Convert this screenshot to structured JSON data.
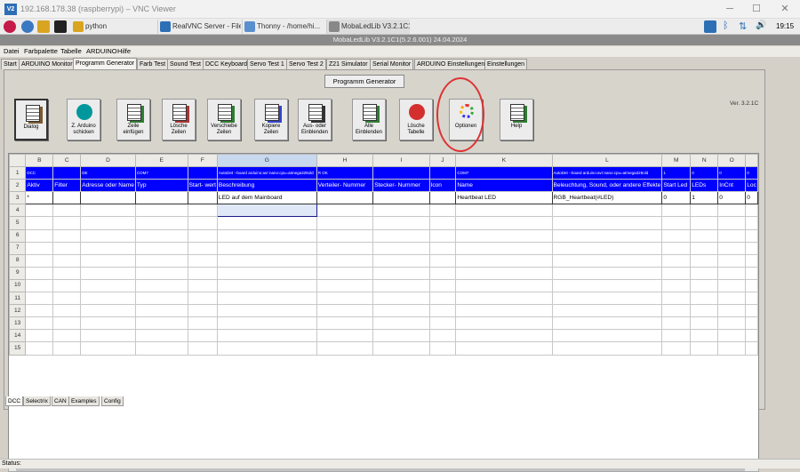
{
  "vnc": {
    "title": "192.168.178.38 (raspberrypi) – VNC Viewer",
    "logo_text": "V2",
    "minimize": "─",
    "maximize": "☐",
    "close": "✕"
  },
  "taskbar": {
    "python_label": "python",
    "tasks": [
      "RealVNC Server - File...",
      "Thonny - /home/hi...",
      "MobaLedLib V3.2.1C1(..."
    ],
    "tray_icons": [
      "vnc-icon",
      "bluetooth-icon",
      "network-icon",
      "volume-icon"
    ],
    "time": "19:15"
  },
  "app_title": "MobaLedLib V3.2.1C1(5.2.6.001) 24.04.2024",
  "menu": [
    "Datei",
    "Farbpalette",
    "Tabelle",
    "ARDUINO",
    "Hilfe"
  ],
  "tabs": [
    "Start",
    "ARDUINO Monitor",
    "Programm Generator",
    "Farb Test",
    "Sound Test",
    "DCC Keyboard",
    "Servo Test 1",
    "Servo Test 2",
    "Z21 Simulator",
    "Serial Monitor",
    "ARDUINO Einstellungen",
    "Einstellungen"
  ],
  "active_tab": "Programm Generator",
  "panel_title": "Programm Generator",
  "version": "Ver. 3.2.1C",
  "toolbar": [
    {
      "name": "dialog",
      "label": "Dialog",
      "icon": "dialog-icon",
      "color": "#7a5a30"
    },
    {
      "name": "to-arduino",
      "label": "Z. Arduino\nschicken",
      "icon": "arduino-icon",
      "color": "#00979c"
    },
    {
      "name": "insert-row",
      "label": "Zeile\neinfügen",
      "icon": "insert-row-icon",
      "color": "#2e7d32"
    },
    {
      "name": "delete-rows",
      "label": "Lösche\nZeilen",
      "icon": "delete-rows-icon",
      "color": "#a33"
    },
    {
      "name": "move-rows",
      "label": "Verschiebe\nZeilen",
      "icon": "move-rows-icon",
      "color": "#2e7d32"
    },
    {
      "name": "copy-rows",
      "label": "Kopiere\nZeilen",
      "icon": "copy-rows-icon",
      "color": "#3344cc"
    },
    {
      "name": "hide-show",
      "label": "Aus- oder\nEinblenden",
      "icon": "eye-icon",
      "color": "#333"
    },
    {
      "name": "show-all",
      "label": "Alle\nEinblenden",
      "icon": "show-all-icon",
      "color": "#2e7d32"
    },
    {
      "name": "delete-table",
      "label": "Lösche\nTabelle",
      "icon": "delete-table-icon",
      "color": "#d32f2f"
    },
    {
      "name": "options",
      "label": "Optionen",
      "icon": "options-ring-icon",
      "color": "#555"
    },
    {
      "name": "help",
      "label": "Help",
      "icon": "help-icon",
      "color": "#2e7d32"
    }
  ],
  "grid": {
    "columns": [
      "",
      "B",
      "C",
      "D",
      "E",
      "F",
      "G",
      "H",
      "I",
      "J",
      "K",
      "L",
      "M",
      "N",
      "O",
      ""
    ],
    "row1": [
      "1",
      "DCC",
      "",
      "DE",
      "COM7",
      "",
      "AutoDet --board arduino:avr:nano:cpu=atmega328old",
      "R OK",
      "",
      "",
      "COM7",
      "AutoDet --board arduino:avr:nano:cpu=atmega328old",
      "1",
      "0",
      "0",
      "0"
    ],
    "row2": [
      "2",
      "Aktiv",
      "Filter",
      "Adresse oder Name",
      "Typ",
      "Start- wert",
      "Beschreibung",
      "Verteiler- Nummer",
      "Stecker- Nummer",
      "Icon",
      "Name",
      "Beleuchtung, Sound, oder andere Effekte",
      "Start Led",
      "LEDs",
      "InCnt",
      "Loc"
    ],
    "row3": [
      "3",
      "*",
      "",
      "",
      "",
      "",
      "LED auf dem Mainboard",
      "",
      "",
      "",
      "Heartbeat LED",
      "RGB_Heartbeat(#LED)",
      "0",
      "1",
      "0",
      "0"
    ],
    "empty_rows": [
      "4",
      "5",
      "6",
      "7",
      "8",
      "9",
      "10",
      "11",
      "12",
      "13",
      "14",
      "15"
    ]
  },
  "bottom_tabs": [
    "DCC",
    "Selectrix",
    "CAN",
    "Examples",
    "Config"
  ],
  "status": "Status:"
}
